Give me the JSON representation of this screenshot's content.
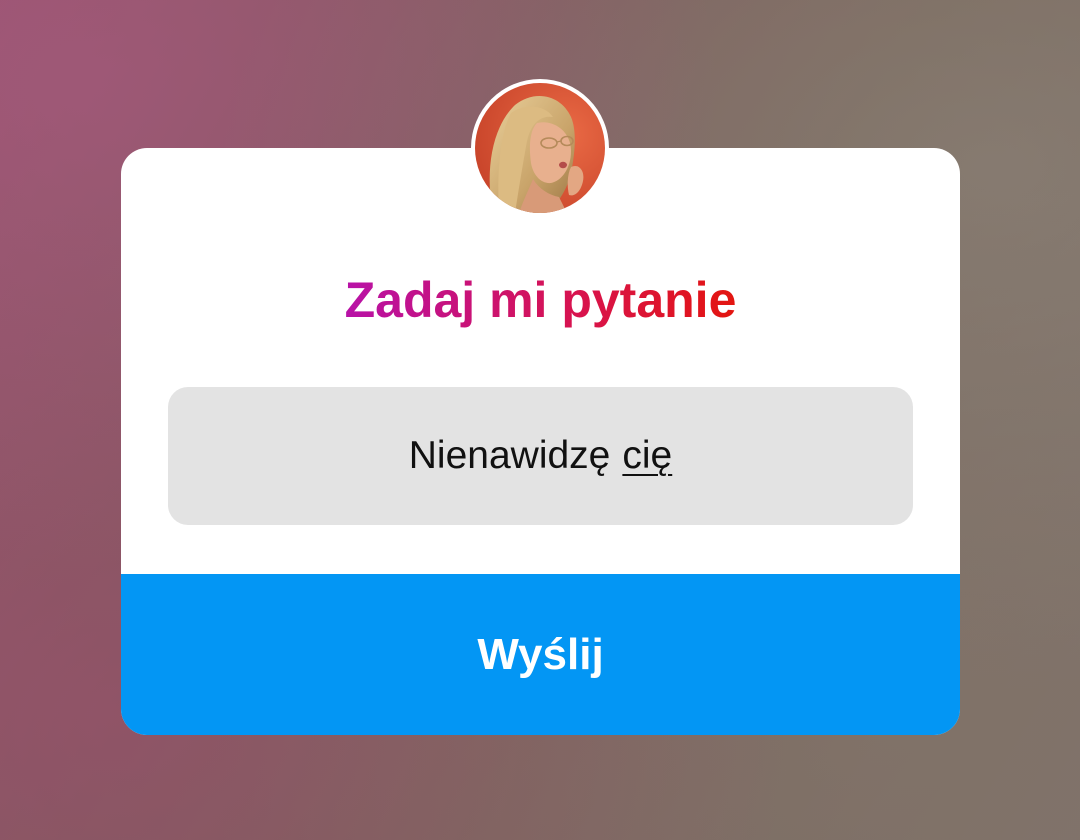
{
  "background": {
    "tone": "blurred mauve-brown photo"
  },
  "question_sticker": {
    "avatar": {
      "icon": "profile-photo-avatar",
      "bg_color": "#d9532f"
    },
    "title": "Zadaj mi pytanie",
    "title_gradient": [
      "#b812a7",
      "#d8134d",
      "#e3150f"
    ],
    "answer": {
      "text_before": "Nienawidzę",
      "text_underlined": "cię"
    },
    "answer_bg_color": "#e3e3e3",
    "send_label": "Wyślij",
    "send_color": "#0396f4"
  }
}
